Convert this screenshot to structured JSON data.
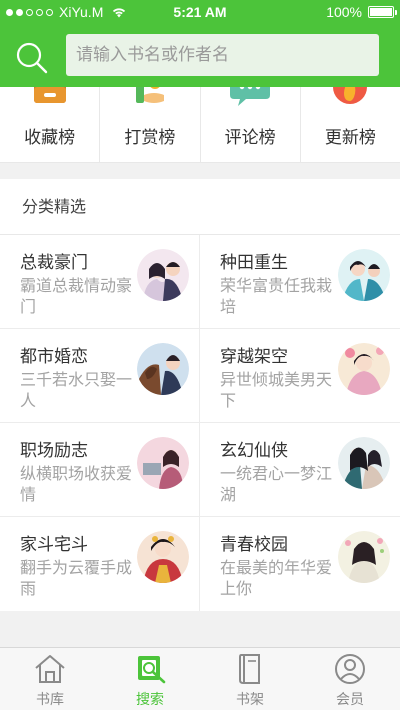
{
  "status_bar": {
    "carrier": "XiYu.M",
    "time": "5:21 AM",
    "battery": "100%"
  },
  "search": {
    "placeholder": "请输入书名或作者名"
  },
  "rankings": [
    {
      "label": "收藏榜",
      "icon": "drawer-icon"
    },
    {
      "label": "打赏榜",
      "icon": "reward-hand-icon"
    },
    {
      "label": "评论榜",
      "icon": "chat-bubble-icon"
    },
    {
      "label": "更新榜",
      "icon": "flame-icon"
    }
  ],
  "section": {
    "title": "分类精选",
    "categories": [
      {
        "title": "总裁豪门",
        "desc": "霸道总裁情动豪门"
      },
      {
        "title": "种田重生",
        "desc": "荣华富贵任我栽培"
      },
      {
        "title": "都市婚恋",
        "desc": "三千若水只娶一人"
      },
      {
        "title": "穿越架空",
        "desc": "异世倾城美男天下"
      },
      {
        "title": "职场励志",
        "desc": "纵横职场收获爱情"
      },
      {
        "title": "玄幻仙侠",
        "desc": "一统君心一梦江湖"
      },
      {
        "title": "家斗宅斗",
        "desc": "翻手为云覆手成雨"
      },
      {
        "title": "青春校园",
        "desc": "在最美的年华爱上你"
      }
    ]
  },
  "tabs": [
    {
      "label": "书库",
      "icon": "house-icon",
      "active": false
    },
    {
      "label": "搜索",
      "icon": "book-search-icon",
      "active": true
    },
    {
      "label": "书架",
      "icon": "bookshelf-icon",
      "active": false
    },
    {
      "label": "会员",
      "icon": "user-icon",
      "active": false
    }
  ],
  "colors": {
    "brand": "#4cc43a",
    "search_bg": "#e9f3e7"
  }
}
